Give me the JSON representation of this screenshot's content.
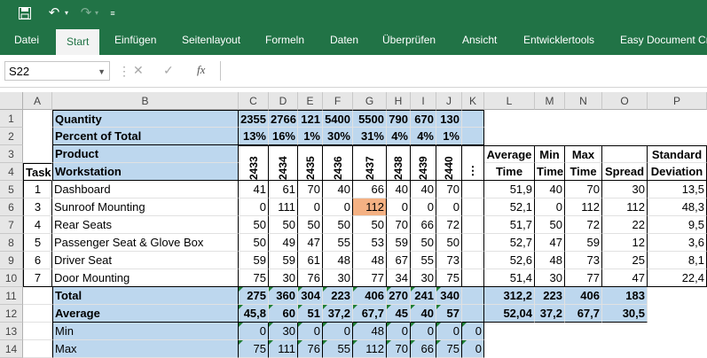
{
  "ribbon": {
    "tabs": [
      "Datei",
      "Start",
      "Einfügen",
      "Seitenlayout",
      "Formeln",
      "Daten",
      "Überprüfen",
      "Ansicht",
      "Entwicklertools",
      "Easy Document Cr"
    ],
    "active_tab": "Start"
  },
  "formula_bar": {
    "name_box": "S22",
    "formula": ""
  },
  "columns": [
    "A",
    "B",
    "C",
    "D",
    "E",
    "F",
    "G",
    "H",
    "I",
    "J",
    "K",
    "L",
    "M",
    "N",
    "O",
    "P"
  ],
  "rows": [
    "1",
    "2",
    "3",
    "4",
    "5",
    "6",
    "7",
    "8",
    "9",
    "10",
    "11",
    "12",
    "13",
    "14"
  ],
  "sheet": {
    "quantity_label": "Quantity",
    "quantity": [
      "2355",
      "2766",
      "121",
      "5400",
      "5500",
      "790",
      "670",
      "130"
    ],
    "percent_label": "Percent of Total",
    "percent": [
      "13%",
      "16%",
      "1%",
      "30%",
      "31%",
      "4%",
      "4%",
      "1%"
    ],
    "product_label": "Product",
    "task_label": "Task",
    "workstation_label": "Workstation",
    "products": [
      "2433",
      "2434",
      "2435",
      "2436",
      "2437",
      "2438",
      "2439",
      "2440"
    ],
    "k_marker": "⋮",
    "stat_headers": {
      "avg_time_1": "Average",
      "avg_time_2": "Time",
      "min_time_1": "Min",
      "min_time_2": "Time",
      "max_time_1": "Max",
      "max_time_2": "Time",
      "spread": "Spread",
      "std_1": "Standard",
      "std_2": "Deviation"
    },
    "tasks": [
      {
        "task": "1",
        "ws": "Dashboard",
        "vals": [
          "41",
          "61",
          "70",
          "40",
          "66",
          "40",
          "40",
          "70"
        ],
        "avg": "51,9",
        "min": "40",
        "max": "70",
        "spread": "30",
        "std": "13,5"
      },
      {
        "task": "3",
        "ws": "Sunroof Mounting",
        "vals": [
          "0",
          "111",
          "0",
          "0",
          "112",
          "0",
          "0",
          "0"
        ],
        "avg": "52,1",
        "min": "0",
        "max": "112",
        "spread": "112",
        "std": "48,3"
      },
      {
        "task": "4",
        "ws": "Rear Seats",
        "vals": [
          "50",
          "50",
          "50",
          "50",
          "50",
          "70",
          "66",
          "72"
        ],
        "avg": "51,7",
        "min": "50",
        "max": "72",
        "spread": "22",
        "std": "9,5"
      },
      {
        "task": "5",
        "ws": "Passenger Seat & Glove Box",
        "vals": [
          "50",
          "49",
          "47",
          "55",
          "53",
          "59",
          "50",
          "50"
        ],
        "avg": "52,7",
        "min": "47",
        "max": "59",
        "spread": "12",
        "std": "3,6"
      },
      {
        "task": "6",
        "ws": "Driver Seat",
        "vals": [
          "59",
          "59",
          "61",
          "48",
          "48",
          "67",
          "55",
          "73"
        ],
        "avg": "52,6",
        "min": "48",
        "max": "73",
        "spread": "25",
        "std": "8,1"
      },
      {
        "task": "7",
        "ws": "Door Mounting",
        "vals": [
          "75",
          "30",
          "76",
          "30",
          "77",
          "34",
          "30",
          "75"
        ],
        "avg": "51,4",
        "min": "30",
        "max": "77",
        "spread": "47",
        "std": "22,4"
      }
    ],
    "total_label": "Total",
    "total": [
      "275",
      "360",
      "304",
      "223",
      "406",
      "270",
      "241",
      "340"
    ],
    "total_stats": {
      "avg": "312,2",
      "min": "223",
      "max": "406",
      "spread": "183"
    },
    "average_label": "Average",
    "average": [
      "45,8",
      "60",
      "51",
      "37,2",
      "67,7",
      "45",
      "40",
      "57"
    ],
    "average_stats": {
      "avg": "52,04",
      "min": "37,2",
      "max": "67,7",
      "spread": "30,5"
    },
    "min_label": "Min",
    "min_row": [
      "0",
      "30",
      "0",
      "0",
      "48",
      "0",
      "0",
      "0",
      "0"
    ],
    "max_label": "Max",
    "max_row": [
      "75",
      "111",
      "76",
      "55",
      "112",
      "70",
      "66",
      "75",
      "0"
    ]
  },
  "colors": {
    "excel_green": "#217346",
    "header_blue": "#bdd7ee",
    "highlight_orange": "#f4b183"
  }
}
